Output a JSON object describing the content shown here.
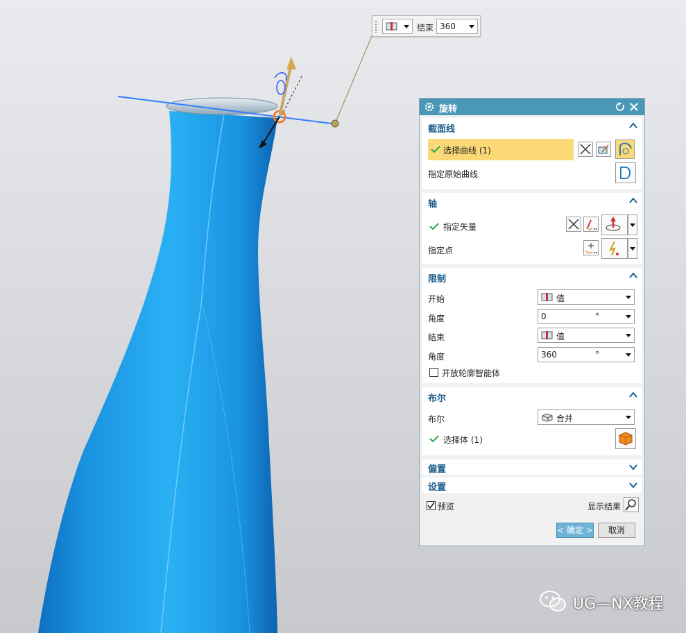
{
  "mini_toolbar": {
    "end_label": "结束",
    "end_value": "360"
  },
  "dialog": {
    "title": "旋转",
    "section_line": {
      "title": "截面线",
      "select_curve": "选择曲线 (1)",
      "specify_original": "指定原始曲线"
    },
    "axis": {
      "title": "轴",
      "specify_vector": "指定矢量",
      "specify_point": "指定点"
    },
    "limits": {
      "title": "限制",
      "start_label": "开始",
      "start_value": "值",
      "start_angle_label": "角度",
      "start_angle_value": "0",
      "end_label": "结束",
      "end_value": "值",
      "end_angle_label": "角度",
      "end_angle_value": "360",
      "degree_unit": "°",
      "open_profile": "开放轮廓智能体"
    },
    "boolean": {
      "title": "布尔",
      "label": "布尔",
      "value": "合并",
      "select_body": "选择体 (1)"
    },
    "offset_title": "偏置",
    "settings_title": "设置",
    "preview_label": "预览",
    "show_result": "显示结果",
    "ok": "< 确定 >",
    "cancel": "取消"
  },
  "watermark": "UG—NX教程",
  "colors": {
    "title_bar": "#4b97b7",
    "highlight": "#fbd977",
    "check_green": "#2aa84a",
    "model_blue": "#1a9fe6",
    "section_header": "#1b5e8c"
  }
}
